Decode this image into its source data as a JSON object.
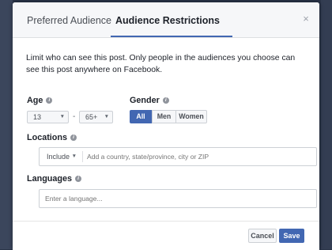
{
  "tabs": [
    {
      "label": "Preferred Audience",
      "active": false
    },
    {
      "label": "Audience Restrictions",
      "active": true
    }
  ],
  "close_icon": "×",
  "description": "Limit who can see this post. Only people in the audiences you choose can see this post anywhere on Facebook.",
  "age": {
    "label": "Age",
    "min_value": "13",
    "separator": "-",
    "max_value": "65+"
  },
  "gender": {
    "label": "Gender",
    "options": [
      "All",
      "Men",
      "Women"
    ],
    "selected": "All"
  },
  "locations": {
    "label": "Locations",
    "include_value": "Include",
    "placeholder": "Add a country, state/province, city or ZIP"
  },
  "languages": {
    "label": "Languages",
    "placeholder": "Enter a language..."
  },
  "info_icon": "i",
  "caret_icon": "▼",
  "buttons": {
    "cancel": "Cancel",
    "save": "Save"
  },
  "colors": {
    "accent": "#4267b2",
    "backdrop": "#2a3448"
  }
}
